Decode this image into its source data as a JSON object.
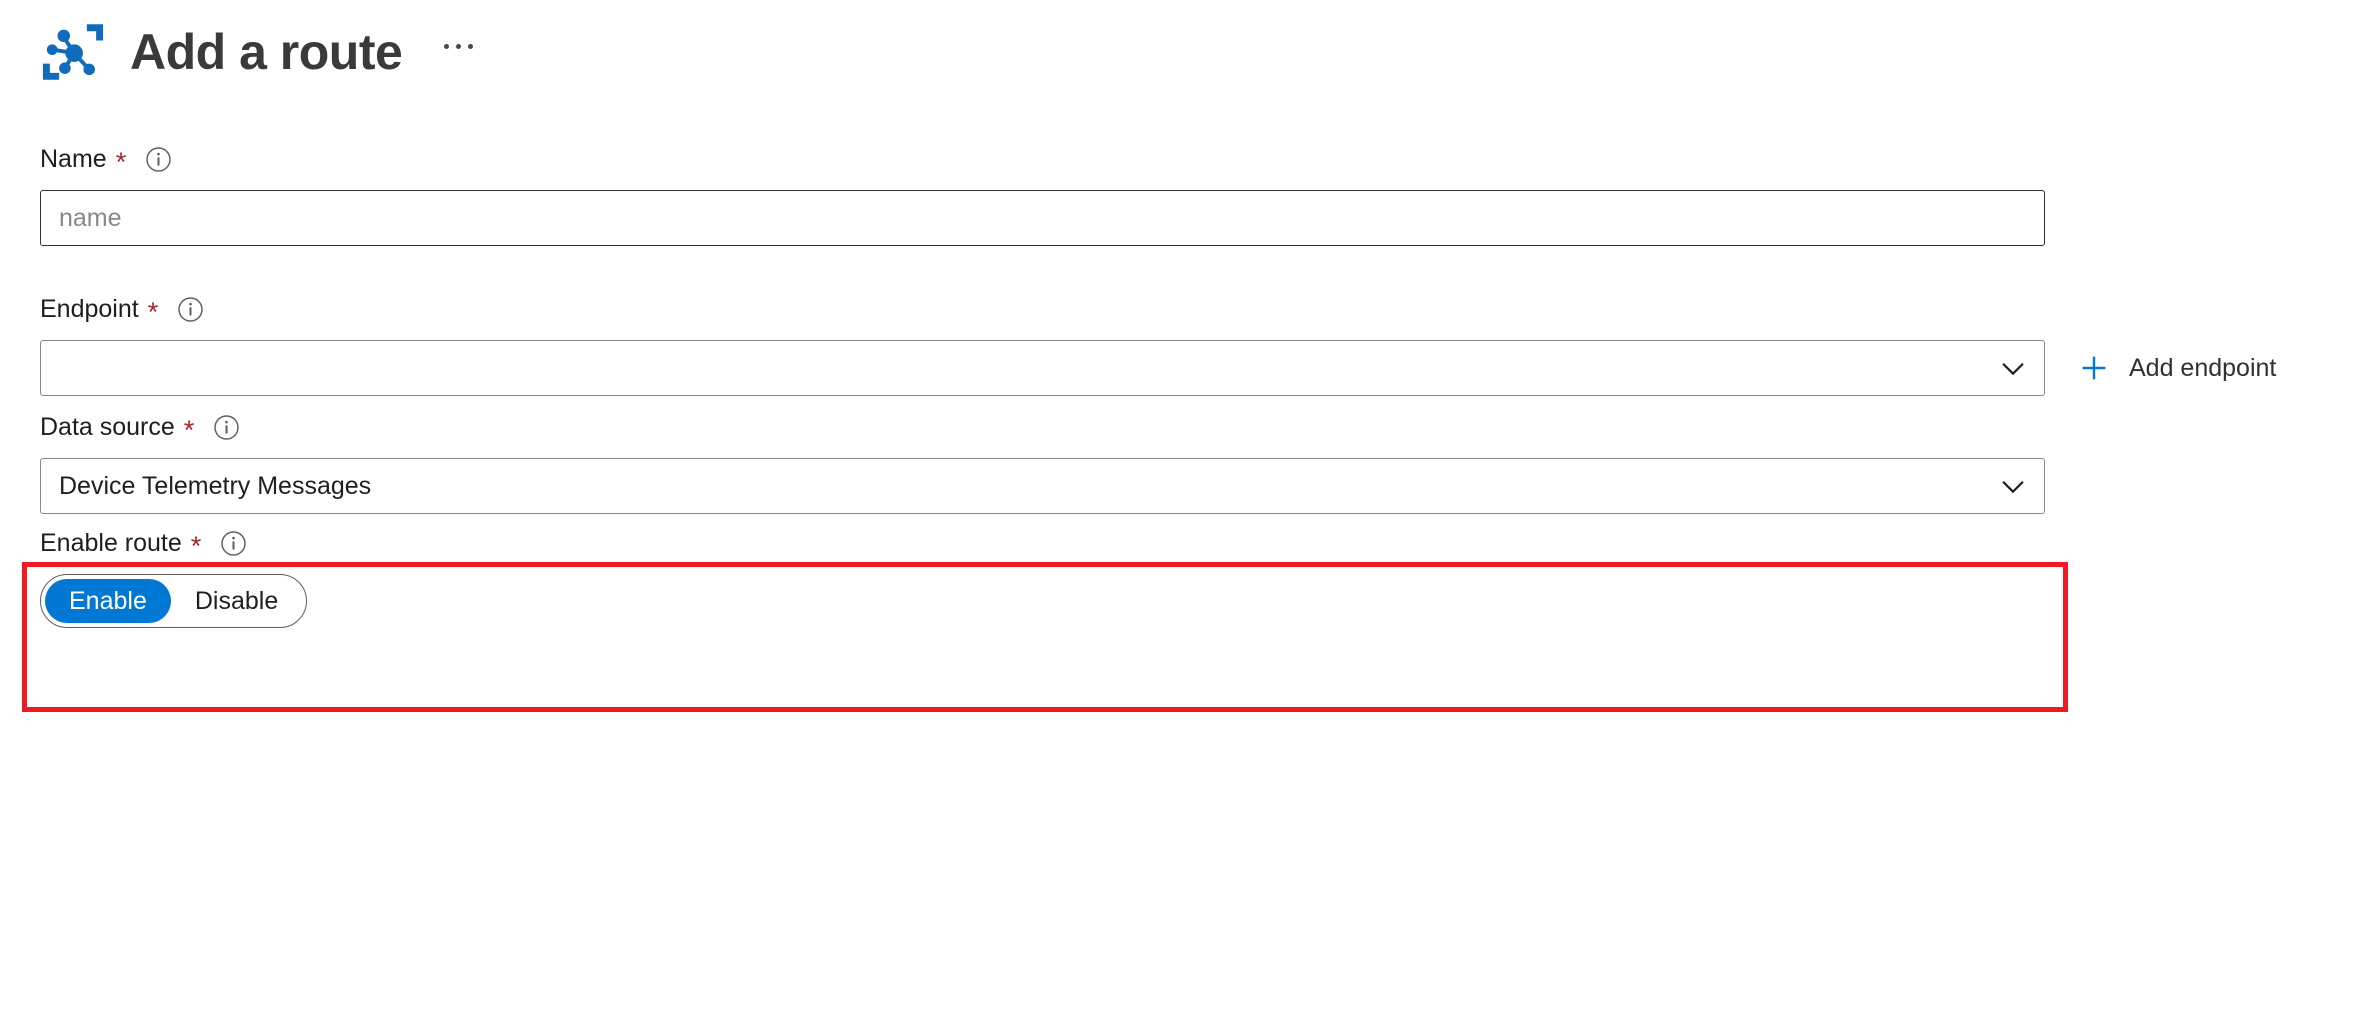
{
  "header": {
    "title": "Add a route",
    "icon": "route-hub-icon",
    "more_menu": "…"
  },
  "theme": {
    "accent_blue": "#0078d4",
    "required_red": "#a4262c",
    "annotation_red": "#ee1b24",
    "text_primary": "#201f1e",
    "placeholder_gray": "#8a8886",
    "border_gray": "#8a8886"
  },
  "form": {
    "name_field": {
      "label": "Name",
      "required_marker": "*",
      "info_tooltip": "info-icon",
      "placeholder": "name",
      "value": ""
    },
    "endpoint_field": {
      "label": "Endpoint",
      "required_marker": "*",
      "info_tooltip": "info-icon",
      "value": "",
      "add_endpoint_label": "Add endpoint",
      "add_icon": "plus-icon",
      "chevron": "chevron-down-icon"
    },
    "data_source_field": {
      "label": "Data source",
      "required_marker": "*",
      "info_tooltip": "info-icon",
      "value": "Device Telemetry Messages",
      "chevron": "chevron-down-icon",
      "highlighted": true
    },
    "enable_route_field": {
      "label": "Enable route",
      "required_marker": "*",
      "info_tooltip": "info-icon",
      "options": [
        {
          "label": "Enable",
          "selected": true
        },
        {
          "label": "Disable",
          "selected": false
        }
      ]
    }
  }
}
